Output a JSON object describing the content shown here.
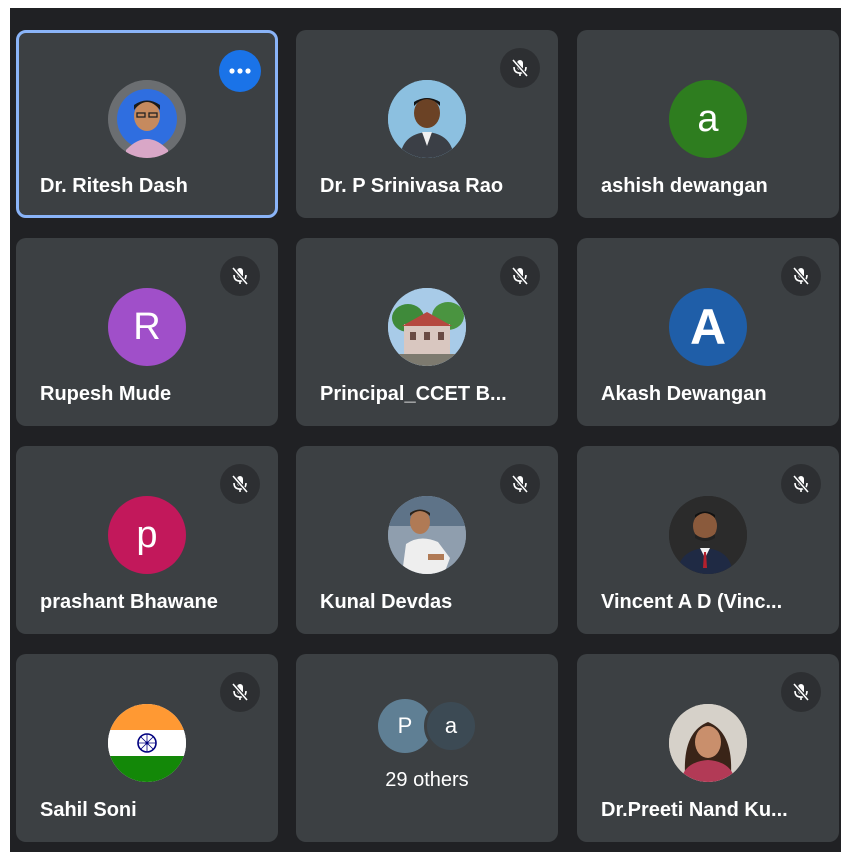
{
  "colors": {
    "background": "#202124",
    "tile": "#3c4043",
    "active_border": "#8ab4f8",
    "more_button": "#1a73e8"
  },
  "participants": [
    {
      "name": "Dr. Ritesh Dash",
      "avatar": "photo",
      "active": true,
      "more_icon": "more-dots-icon"
    },
    {
      "name": "Dr. P Srinivasa Rao",
      "avatar": "photo",
      "muted": true
    },
    {
      "name": "ashish dewangan",
      "avatar": "letter",
      "initial": "a",
      "avatar_color": "#2e7d1f"
    },
    {
      "name": "Rupesh Mude",
      "avatar": "letter",
      "initial": "R",
      "avatar_color": "#a04fc9",
      "muted": true
    },
    {
      "name": "Principal_CCET B...",
      "avatar": "photo",
      "muted": true
    },
    {
      "name": "Akash Dewangan",
      "avatar": "letter",
      "initial": "A",
      "avatar_color": "#1f5ea8",
      "muted": true
    },
    {
      "name": "prashant Bhawane",
      "avatar": "letter",
      "initial": "p",
      "avatar_color": "#c2185b",
      "muted": true
    },
    {
      "name": "Kunal Devdas",
      "avatar": "photo",
      "muted": true
    },
    {
      "name": "Vincent A D (Vinc...",
      "avatar": "photo",
      "muted": true
    },
    {
      "name": "Sahil Soni",
      "avatar": "photo",
      "muted": true
    }
  ],
  "others_tile": {
    "label": "29 others",
    "initials": [
      "P",
      "a"
    ],
    "initial_colors": [
      "#5f7f94",
      "#3c4a54"
    ]
  },
  "last_tile": {
    "name": "Dr.Preeti Nand Ku...",
    "avatar": "photo",
    "muted": true
  }
}
